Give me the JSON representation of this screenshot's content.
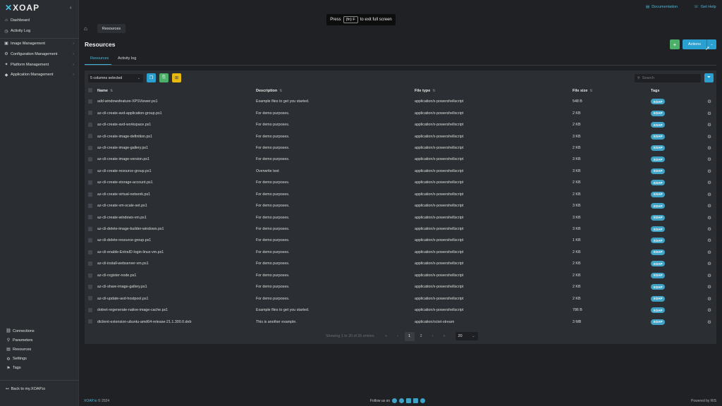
{
  "app": {
    "logo": "XOAP"
  },
  "sidebar": {
    "items": [
      {
        "label": "Dashboard",
        "icon": "house-icon",
        "glyph": "⌂",
        "has_children": false
      },
      {
        "label": "Activity Log",
        "icon": "clock-icon",
        "glyph": "◷",
        "has_children": false
      },
      {
        "label": "Image Management",
        "icon": "image-icon",
        "glyph": "▣",
        "has_children": true
      },
      {
        "label": "Configuration Management",
        "icon": "config-icon",
        "glyph": "⚙",
        "has_children": true
      },
      {
        "label": "Platform Management",
        "icon": "platform-icon",
        "glyph": "✦",
        "has_children": true
      },
      {
        "label": "Application Management",
        "icon": "app-icon",
        "glyph": "◆",
        "has_children": true
      }
    ],
    "bottom": [
      {
        "label": "Connections",
        "glyph": "⛓"
      },
      {
        "label": "Parameters",
        "glyph": "⚲"
      },
      {
        "label": "Resources",
        "glyph": "▤"
      },
      {
        "label": "Settings",
        "glyph": "⚙"
      },
      {
        "label": "Tags",
        "glyph": "⚑"
      }
    ],
    "back_label": "Back to my.XOAP.io"
  },
  "topbar": {
    "documentation": "Documentation",
    "get_help": "Get Help",
    "fullscreen_prefix": "Press",
    "fullscreen_key": "(fn) F",
    "fullscreen_suffix": "to exit full screen"
  },
  "breadcrumb": {
    "current": "Resources"
  },
  "page": {
    "title": "Resources",
    "actions_label": "Actions",
    "add_label": "+"
  },
  "tabs": [
    {
      "label": "Resources",
      "active": true
    },
    {
      "label": "Activity log",
      "active": false
    }
  ],
  "toolbar": {
    "columns_selected": "5 columns selected",
    "search_placeholder": "Search"
  },
  "table": {
    "columns": [
      "Name",
      "Description",
      "File type",
      "File size",
      "Tags"
    ],
    "rows": [
      {
        "name": "add-windowsfeature-XPSViewer.ps1",
        "description": "Example files to get you started.",
        "type": "application/x-powershellscript",
        "size": "548 B",
        "tag": "XOAP"
      },
      {
        "name": "az-cli-create-avd-application-group.ps1",
        "description": "For demo purposes.",
        "type": "application/x-powershellscript",
        "size": "2 KB",
        "tag": "XOAP"
      },
      {
        "name": "az-cli-create-avd-workspace.ps1",
        "description": "For demo purposes.",
        "type": "application/x-powershellscript",
        "size": "2 KB",
        "tag": "XOAP"
      },
      {
        "name": "az-cli-create-image-definition.ps1",
        "description": "For demo purposes.",
        "type": "application/x-powershellscript",
        "size": "3 KB",
        "tag": "XOAP"
      },
      {
        "name": "az-cli-create-image-gallery.ps1",
        "description": "For demo purposes.",
        "type": "application/x-powershellscript",
        "size": "2 KB",
        "tag": "XOAP"
      },
      {
        "name": "az-cli-create-image-version.ps1",
        "description": "For demo purposes.",
        "type": "application/x-powershellscript",
        "size": "3 KB",
        "tag": "XOAP"
      },
      {
        "name": "az-cli-create-resource-group.ps1",
        "description": "Overwrite test",
        "type": "application/x-powershellscript",
        "size": "3 KB",
        "tag": "XOAP"
      },
      {
        "name": "az-cli-create-storage-account.ps1",
        "description": "For demo purposes.",
        "type": "application/x-powershellscript",
        "size": "2 KB",
        "tag": "XOAP"
      },
      {
        "name": "az-cli-create-virtual-network.ps1",
        "description": "For demo purposes.",
        "type": "application/x-powershellscript",
        "size": "2 KB",
        "tag": "XOAP"
      },
      {
        "name": "az-cli-create-vm-scale-set.ps1",
        "description": "For demo purposes.",
        "type": "application/x-powershellscript",
        "size": "3 KB",
        "tag": "XOAP"
      },
      {
        "name": "az-cli-create-windows-vm.ps1",
        "description": "For demo purposes.",
        "type": "application/x-powershellscript",
        "size": "3 KB",
        "tag": "XOAP"
      },
      {
        "name": "az-cli-delete-image-builder-windows.ps1",
        "description": "For demo purposes.",
        "type": "application/x-powershellscript",
        "size": "3 KB",
        "tag": "XOAP"
      },
      {
        "name": "az-cli-delete-resource-group.ps1",
        "description": "For demo purposes.",
        "type": "application/x-powershellscript",
        "size": "1 KB",
        "tag": "XOAP"
      },
      {
        "name": "az-cli-enable-EntraID-login-linux-vm.ps1",
        "description": "For demo purposes.",
        "type": "application/x-powershellscript",
        "size": "2 KB",
        "tag": "XOAP"
      },
      {
        "name": "az-cli-install-webserver-vm.ps1",
        "description": "For demo purposes.",
        "type": "application/x-powershellscript",
        "size": "2 KB",
        "tag": "XOAP"
      },
      {
        "name": "az-cli-register-node.ps1",
        "description": "For demo purposes.",
        "type": "application/x-powershellscript",
        "size": "2 KB",
        "tag": "XOAP"
      },
      {
        "name": "az-cli-share-image-gallery.ps1",
        "description": "For demo purposes.",
        "type": "application/x-powershellscript",
        "size": "2 KB",
        "tag": "XOAP"
      },
      {
        "name": "az-cli-update-avd-hostpool.ps1",
        "description": "For demo purposes.",
        "type": "application/x-powershellscript",
        "size": "2 KB",
        "tag": "XOAP"
      },
      {
        "name": "dotnet-regenerate-native-image-cache.ps1",
        "description": "Example files to get you started.",
        "type": "application/x-powershellscript",
        "size": "786 B",
        "tag": "XOAP"
      },
      {
        "name": "dtclient-extension-ubuntu-amd64-release-21.1.300.0.deb",
        "description": "This is another example.",
        "type": "application/octet-stream",
        "size": "3 MB",
        "tag": "XOAP"
      }
    ]
  },
  "pagination": {
    "info": "Showing 1 to 20 of 26 entries",
    "pages": [
      "1",
      "2"
    ],
    "current": "1",
    "per_page": "20"
  },
  "footer": {
    "brand": "XOAP.io",
    "copyright": "© 2024",
    "follow": "Follow us on",
    "powered": "Powered by RIS"
  },
  "colors": {
    "accent": "#2aa0d0",
    "add": "#4caf6a",
    "warning": "#e8b90f",
    "tag": "#3fa3c7"
  }
}
